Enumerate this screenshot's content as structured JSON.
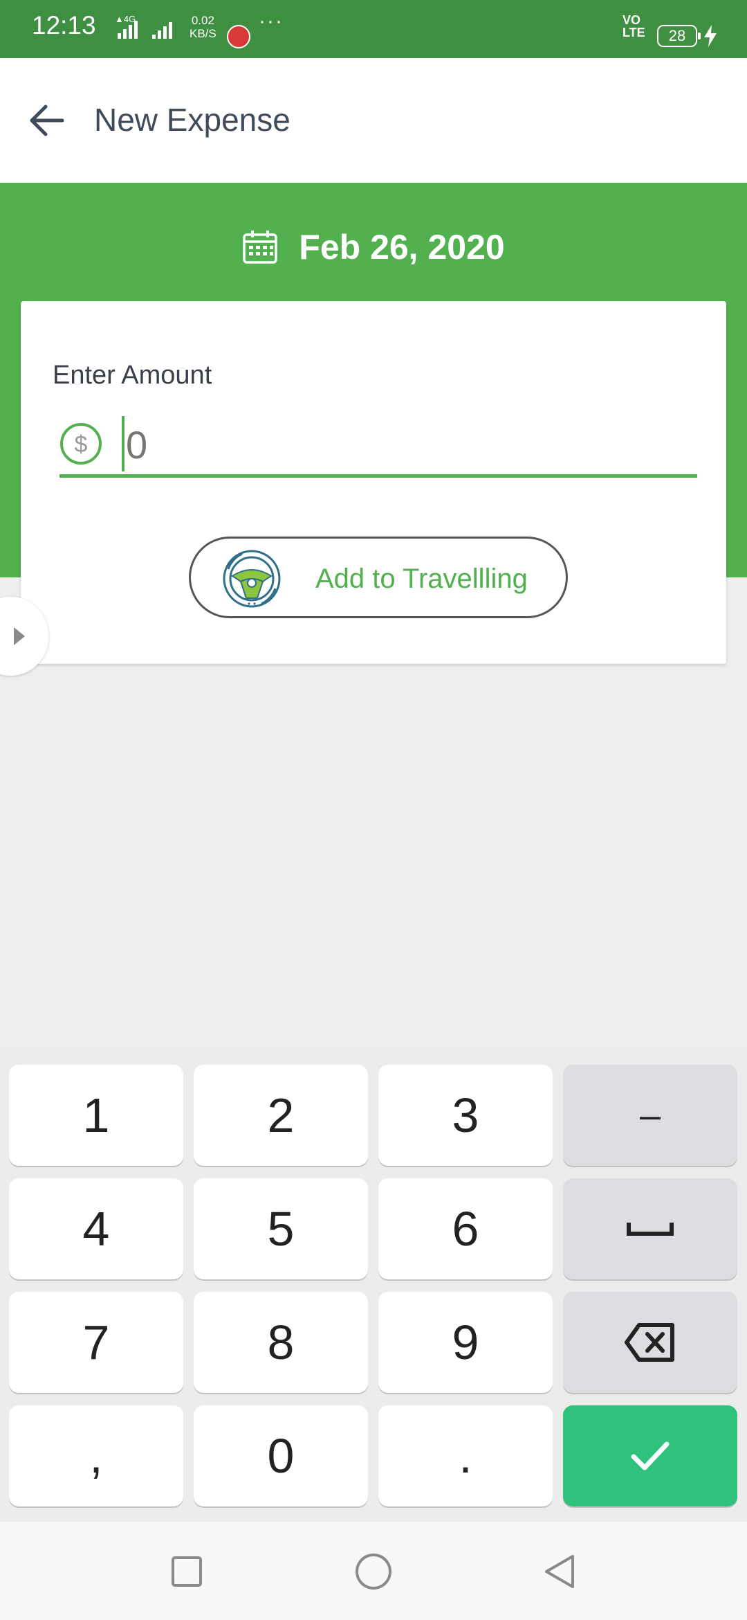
{
  "status_bar": {
    "time": "12:13",
    "network_type": "4G",
    "data_speed": "0.02",
    "data_speed_unit": "KB/S",
    "volte_line1": "VO",
    "volte_line2": "LTE",
    "battery_level": "28"
  },
  "app_bar": {
    "title": "New Expense",
    "back_icon": "arrow-left-icon"
  },
  "date_selector": {
    "icon": "calendar-icon",
    "date": "Feb 26, 2020"
  },
  "amount_card": {
    "label": "Enter Amount",
    "currency_icon": "dollar-circle-icon",
    "amount_placeholder": "0",
    "amount_value": ""
  },
  "category_button": {
    "icon": "steering-wheel-icon",
    "label": "Add to Travellling"
  },
  "side_handle": {
    "icon": "caret-right-icon"
  },
  "keypad": {
    "keys": [
      "1",
      "2",
      "3",
      "−",
      "4",
      "5",
      "6",
      "space",
      "7",
      "8",
      "9",
      "backspace",
      ",",
      "0",
      ".",
      "done"
    ],
    "labels": {
      "k1": "1",
      "k2": "2",
      "k3": "3",
      "minus": "–",
      "k4": "4",
      "k5": "5",
      "k6": "6",
      "k7": "7",
      "k8": "8",
      "k9": "9",
      "comma": ",",
      "k0": "0",
      "dot": "."
    }
  },
  "colors": {
    "status_bar": "#3f8f43",
    "primary_green": "#52b04f",
    "confirm_key": "#2ec27d",
    "title_text": "#3f4a5a"
  },
  "nav_bar": {
    "recents_icon": "square-icon",
    "home_icon": "circle-icon",
    "back_icon": "triangle-back-icon"
  }
}
